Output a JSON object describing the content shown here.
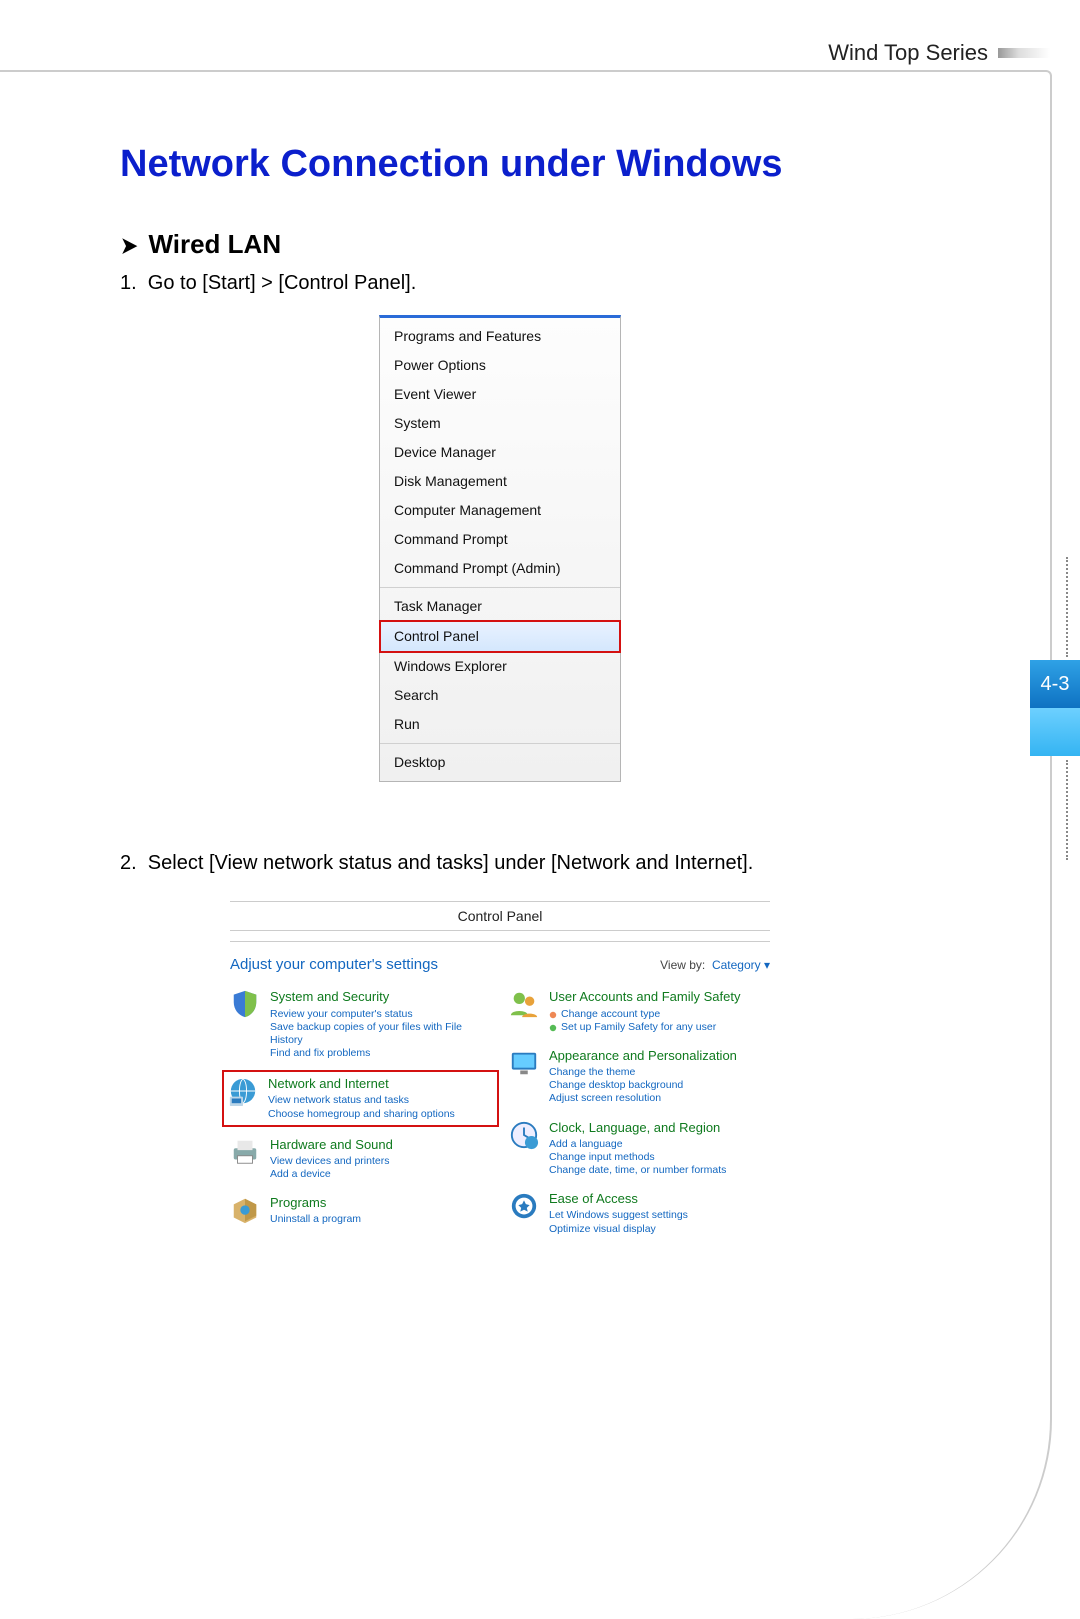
{
  "header": {
    "series": "Wind Top Series"
  },
  "title": "Network Connection under Windows",
  "subtitle": "Wired LAN",
  "steps": {
    "s1": "Go to [Start] > [Control Panel].",
    "s2": "Select [View network status and tasks] under [Network and Internet]."
  },
  "start_menu": {
    "items": [
      {
        "label": "Programs and Features",
        "hl": false
      },
      {
        "label": "Power Options",
        "hl": false
      },
      {
        "label": "Event Viewer",
        "hl": false
      },
      {
        "label": "System",
        "hl": false
      },
      {
        "label": "Device Manager",
        "hl": false
      },
      {
        "label": "Disk Management",
        "hl": false
      },
      {
        "label": "Computer Management",
        "hl": false
      },
      {
        "label": "Command Prompt",
        "hl": false
      },
      {
        "label": "Command Prompt (Admin)",
        "hl": false
      }
    ],
    "items2": [
      {
        "label": "Task Manager",
        "hl": false
      },
      {
        "label": "Control Panel",
        "hl": true
      },
      {
        "label": "Windows Explorer",
        "hl": false
      },
      {
        "label": "Search",
        "hl": false
      },
      {
        "label": "Run",
        "hl": false
      }
    ],
    "items3": [
      {
        "label": "Desktop",
        "hl": false
      }
    ]
  },
  "control_panel": {
    "title": "Control Panel",
    "adjust": "Adjust your computer's settings",
    "viewby_label": "View by:",
    "viewby_value": "Category ▾",
    "left": [
      {
        "head": "System and Security",
        "subs": [
          "Review your computer's status",
          "Save backup copies of your files with File History",
          "Find and fix problems"
        ],
        "boxed": false
      },
      {
        "head": "Network and Internet",
        "subs": [
          "View network status and tasks",
          "Choose homegroup and sharing options"
        ],
        "boxed": true
      },
      {
        "head": "Hardware and Sound",
        "subs": [
          "View devices and printers",
          "Add a device"
        ],
        "boxed": false
      },
      {
        "head": "Programs",
        "subs": [
          "Uninstall a program"
        ],
        "boxed": false
      }
    ],
    "right": [
      {
        "head": "User Accounts and Family Safety",
        "subs": [
          "Change account type",
          "Set up Family Safety for any user"
        ],
        "bulleted": true
      },
      {
        "head": "Appearance and Personalization",
        "subs": [
          "Change the theme",
          "Change desktop background",
          "Adjust screen resolution"
        ]
      },
      {
        "head": "Clock, Language, and Region",
        "subs": [
          "Add a language",
          "Change input methods",
          "Change date, time, or number formats"
        ]
      },
      {
        "head": "Ease of Access",
        "subs": [
          "Let Windows suggest settings",
          "Optimize visual display"
        ]
      }
    ]
  },
  "page_tab": "4-3"
}
